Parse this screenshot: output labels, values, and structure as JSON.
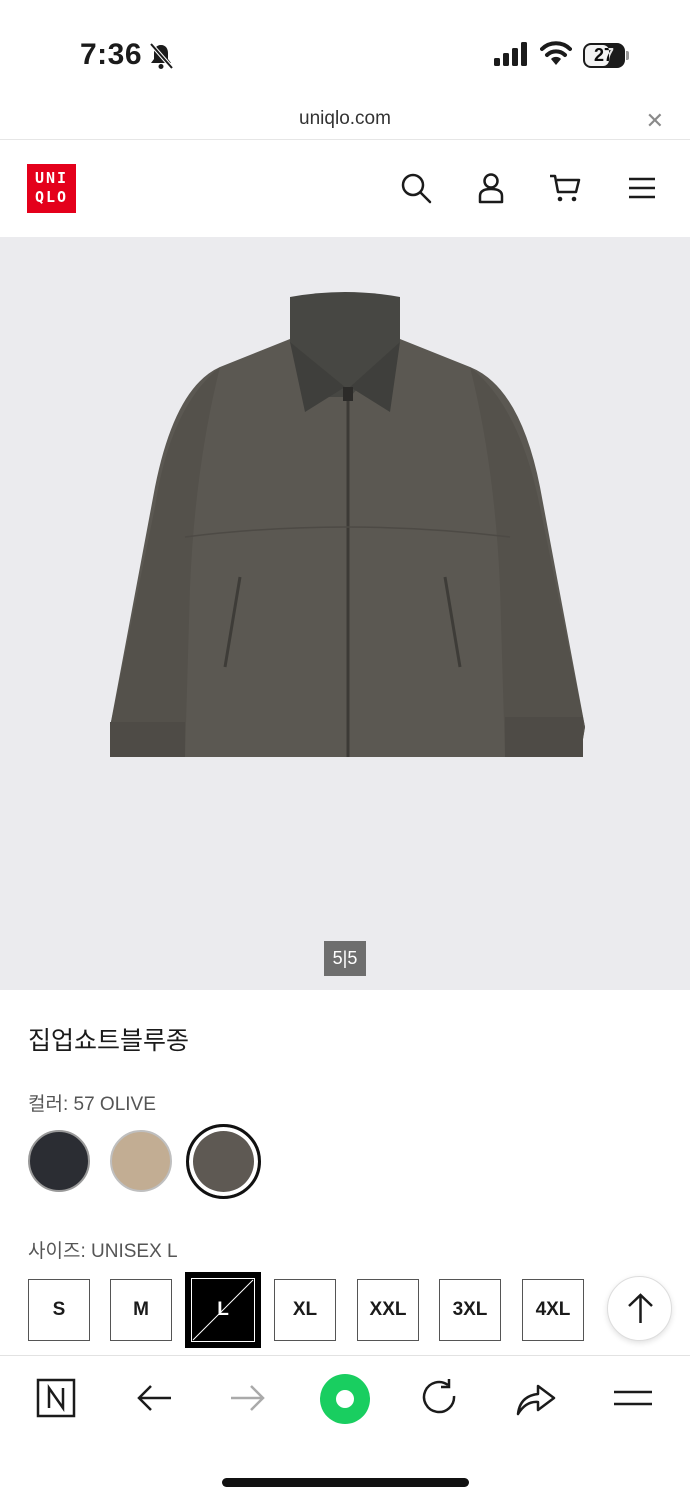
{
  "status_bar": {
    "time": "7:36",
    "battery": "27",
    "icons": [
      "bell-slash-icon",
      "signal-icon",
      "wifi-icon",
      "battery-icon"
    ]
  },
  "browser": {
    "url": "uniqlo.com",
    "close_glyph": "✕"
  },
  "header": {
    "logo_line1": "UNI",
    "logo_line2": "QLO",
    "brand_color": "#e4001b",
    "icons": [
      "search-icon",
      "account-icon",
      "cart-icon",
      "menu-icon"
    ]
  },
  "gallery": {
    "pager": "5|5",
    "background": "#ebebee",
    "image": "olive-zip-up-jacket"
  },
  "product": {
    "title": "집업쇼트블루종",
    "color_label": "컬러: 57 OLIVE",
    "swatches": [
      {
        "name": "navy",
        "color": "#2b2d33",
        "selected": false
      },
      {
        "name": "beige",
        "color": "#c2ad93",
        "selected": false
      },
      {
        "name": "olive",
        "color": "#5e5953",
        "selected": true
      }
    ],
    "size_label": "사이즈: UNISEX L",
    "sizes": [
      {
        "label": "S",
        "selected": false
      },
      {
        "label": "M",
        "selected": false
      },
      {
        "label": "L",
        "selected": true
      },
      {
        "label": "XL",
        "selected": false
      },
      {
        "label": "XXL",
        "selected": false
      },
      {
        "label": "3XL",
        "selected": false
      },
      {
        "label": "4XL",
        "selected": false
      }
    ]
  },
  "toolbar": {
    "icons": [
      "naver-home-icon",
      "back-arrow-icon",
      "forward-arrow-icon",
      "green-dot-icon",
      "reload-icon",
      "share-icon",
      "menu-icon"
    ],
    "accent": "#19ce60"
  }
}
